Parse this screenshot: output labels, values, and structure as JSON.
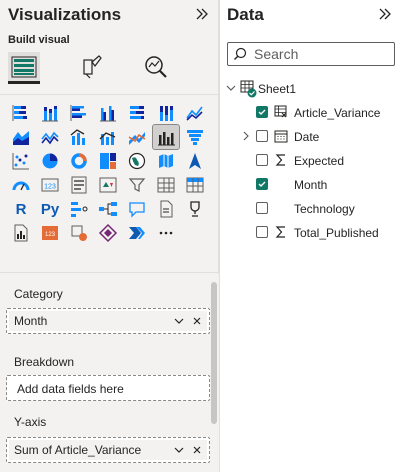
{
  "visualizations": {
    "title": "Visualizations",
    "build_visual_label": "Build visual",
    "tabs": [
      "build-visual",
      "format-visual",
      "analytics"
    ],
    "selected_visual": "line-and-clustered-column-chart",
    "wells": {
      "category": {
        "label": "Category",
        "field": "Month"
      },
      "breakdown": {
        "label": "Breakdown",
        "placeholder": "Add data fields here"
      },
      "y_axis": {
        "label": "Y-axis",
        "field": "Sum of Article_Variance"
      }
    }
  },
  "data": {
    "title": "Data",
    "search_placeholder": "Search",
    "table": "Sheet1",
    "fields": [
      {
        "name": "Article_Variance",
        "checked": true,
        "icon": "calculated-table-icon"
      },
      {
        "name": "Date",
        "checked": false,
        "icon": "calendar-icon",
        "expandable": true
      },
      {
        "name": "Expected",
        "checked": false,
        "icon": "sigma-icon"
      },
      {
        "name": "Month",
        "checked": true,
        "icon": "none"
      },
      {
        "name": "Technology",
        "checked": false,
        "icon": "none"
      },
      {
        "name": "Total_Published",
        "checked": false,
        "icon": "sigma-icon"
      }
    ]
  },
  "colors": {
    "accent_teal": "#117865",
    "viz_blue": "#118dff",
    "viz_navy": "#12239e",
    "viz_orange": "#e66c37"
  }
}
